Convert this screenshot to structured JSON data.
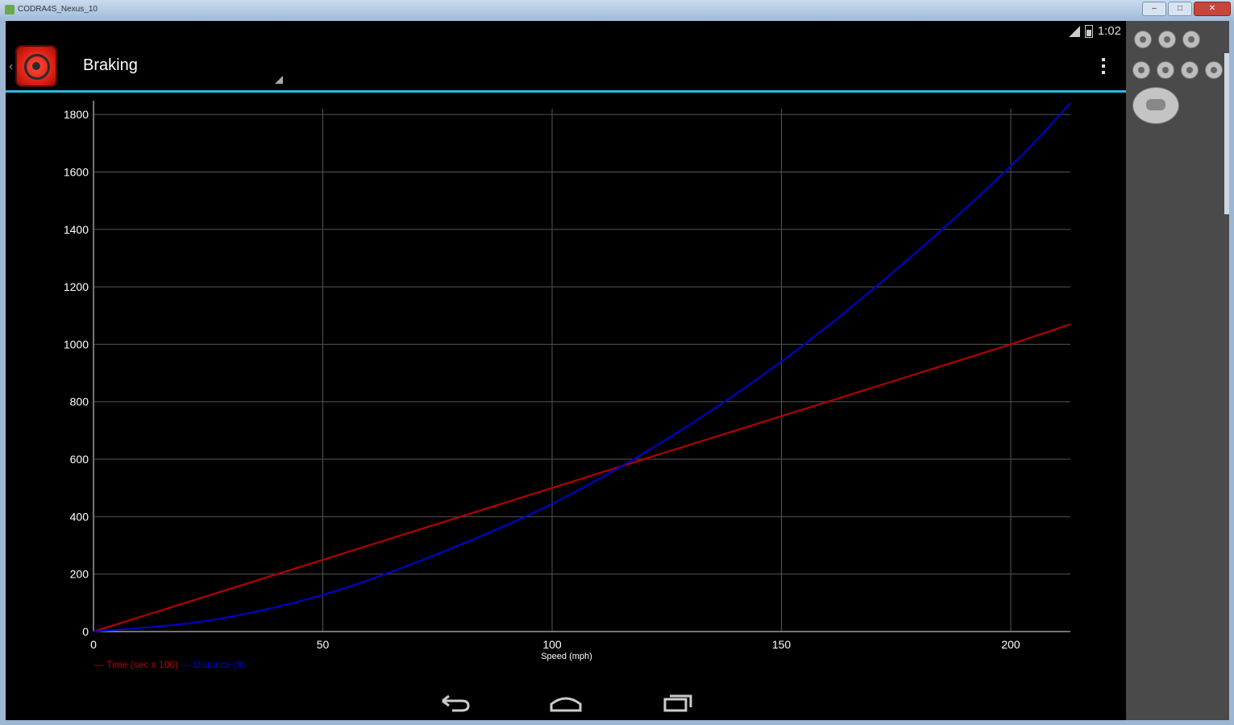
{
  "window": {
    "title": "CODRA4S_Nexus_10",
    "min_label": "–",
    "max_label": "□",
    "close_label": "✕"
  },
  "status": {
    "time": "1:02"
  },
  "actionbar": {
    "title": "Braking"
  },
  "colors": {
    "accent": "#33b5e5",
    "time_series": "#b00000",
    "distance_series": "#0000c8",
    "grid": "#555555",
    "axis_text": "#ffffff"
  },
  "legend": {
    "time_label": "Time (sec x 100)",
    "distance_label": "Distance (ft)"
  },
  "chart_data": {
    "type": "line",
    "xlabel": "Speed (mph)",
    "ylabel": "",
    "xlim": [
      0,
      213
    ],
    "ylim": [
      0,
      1820
    ],
    "x_ticks": [
      0,
      50,
      100,
      150,
      200
    ],
    "y_ticks": [
      0,
      200,
      400,
      600,
      800,
      1000,
      1200,
      1400,
      1600,
      1800
    ],
    "grid": true,
    "legend_position": "bottom-left",
    "series": [
      {
        "name": "Time (sec x 100)",
        "x": [
          0,
          25,
          50,
          75,
          100,
          125,
          150,
          175,
          200,
          213
        ],
        "values": [
          0,
          125,
          250,
          375,
          500,
          625,
          750,
          875,
          1000,
          1070
        ]
      },
      {
        "name": "Distance (ft)",
        "x": [
          0,
          25,
          50,
          75,
          100,
          125,
          150,
          175,
          200,
          213
        ],
        "values": [
          0,
          38,
          128,
          270,
          445,
          670,
          940,
          1260,
          1620,
          1840
        ]
      }
    ]
  }
}
